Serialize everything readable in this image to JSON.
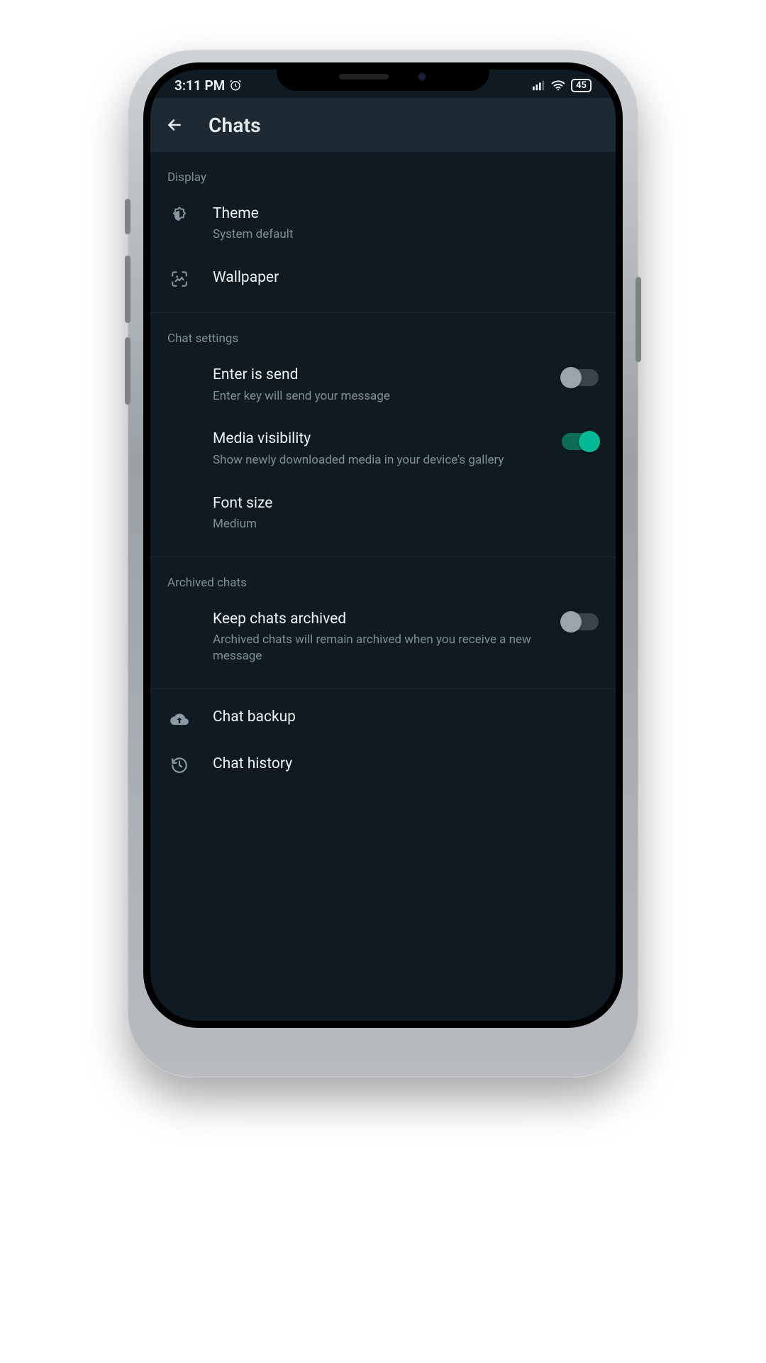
{
  "status": {
    "time": "3:11 PM",
    "battery": "45"
  },
  "header": {
    "title": "Chats"
  },
  "sections": {
    "display": {
      "heading": "Display",
      "theme_label": "Theme",
      "theme_value": "System default",
      "wallpaper_label": "Wallpaper"
    },
    "chat_settings": {
      "heading": "Chat settings",
      "enter_send_label": "Enter is send",
      "enter_send_desc": "Enter key will send your message",
      "enter_send_on": false,
      "media_vis_label": "Media visibility",
      "media_vis_desc": "Show newly downloaded media in your device's gallery",
      "media_vis_on": true,
      "font_size_label": "Font size",
      "font_size_value": "Medium"
    },
    "archived": {
      "heading": "Archived chats",
      "keep_label": "Keep chats archived",
      "keep_desc": "Archived chats will remain archived when you receive a new message",
      "keep_on": false
    },
    "footer": {
      "backup_label": "Chat backup",
      "history_label": "Chat history"
    }
  }
}
